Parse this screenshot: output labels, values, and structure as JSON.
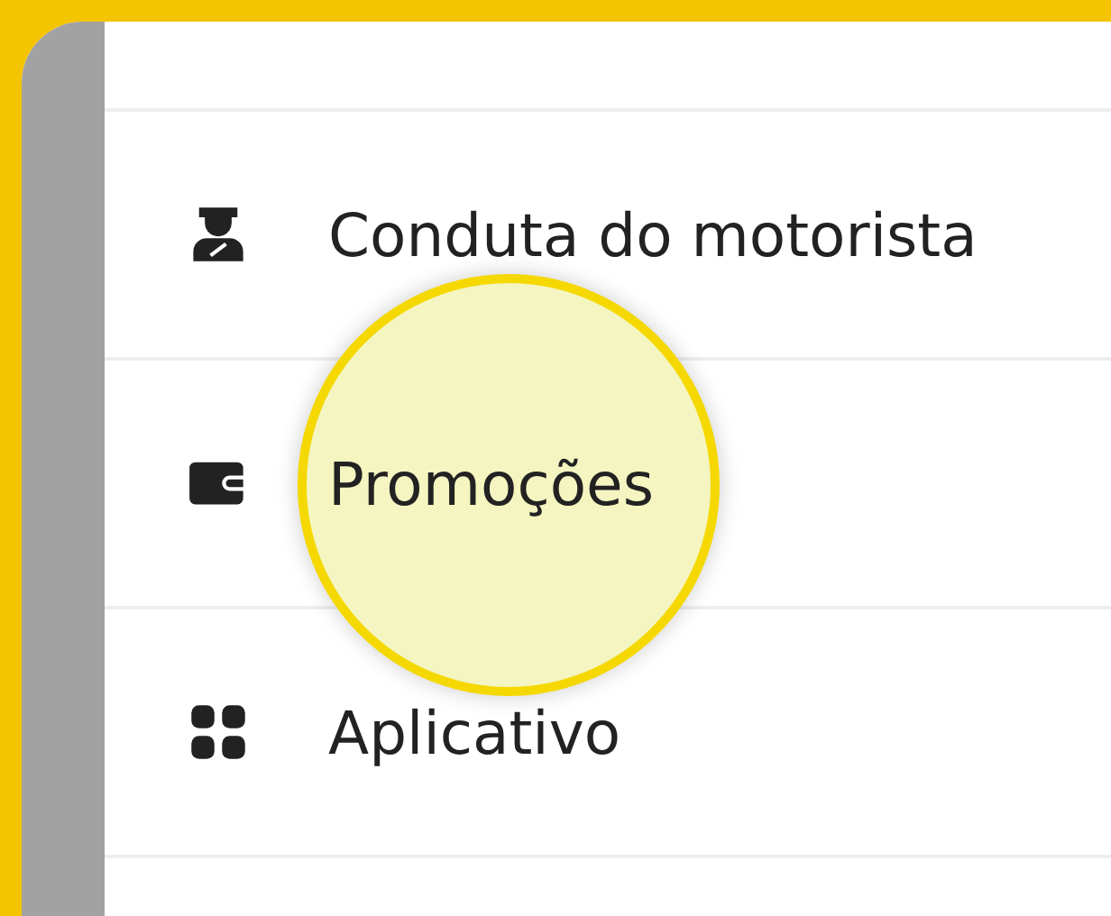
{
  "menu": {
    "items": [
      {
        "label": "Conduta do motorista",
        "selected": false
      },
      {
        "label": "Promoções",
        "selected": true
      },
      {
        "label": "Aplicativo",
        "selected": false
      }
    ]
  }
}
